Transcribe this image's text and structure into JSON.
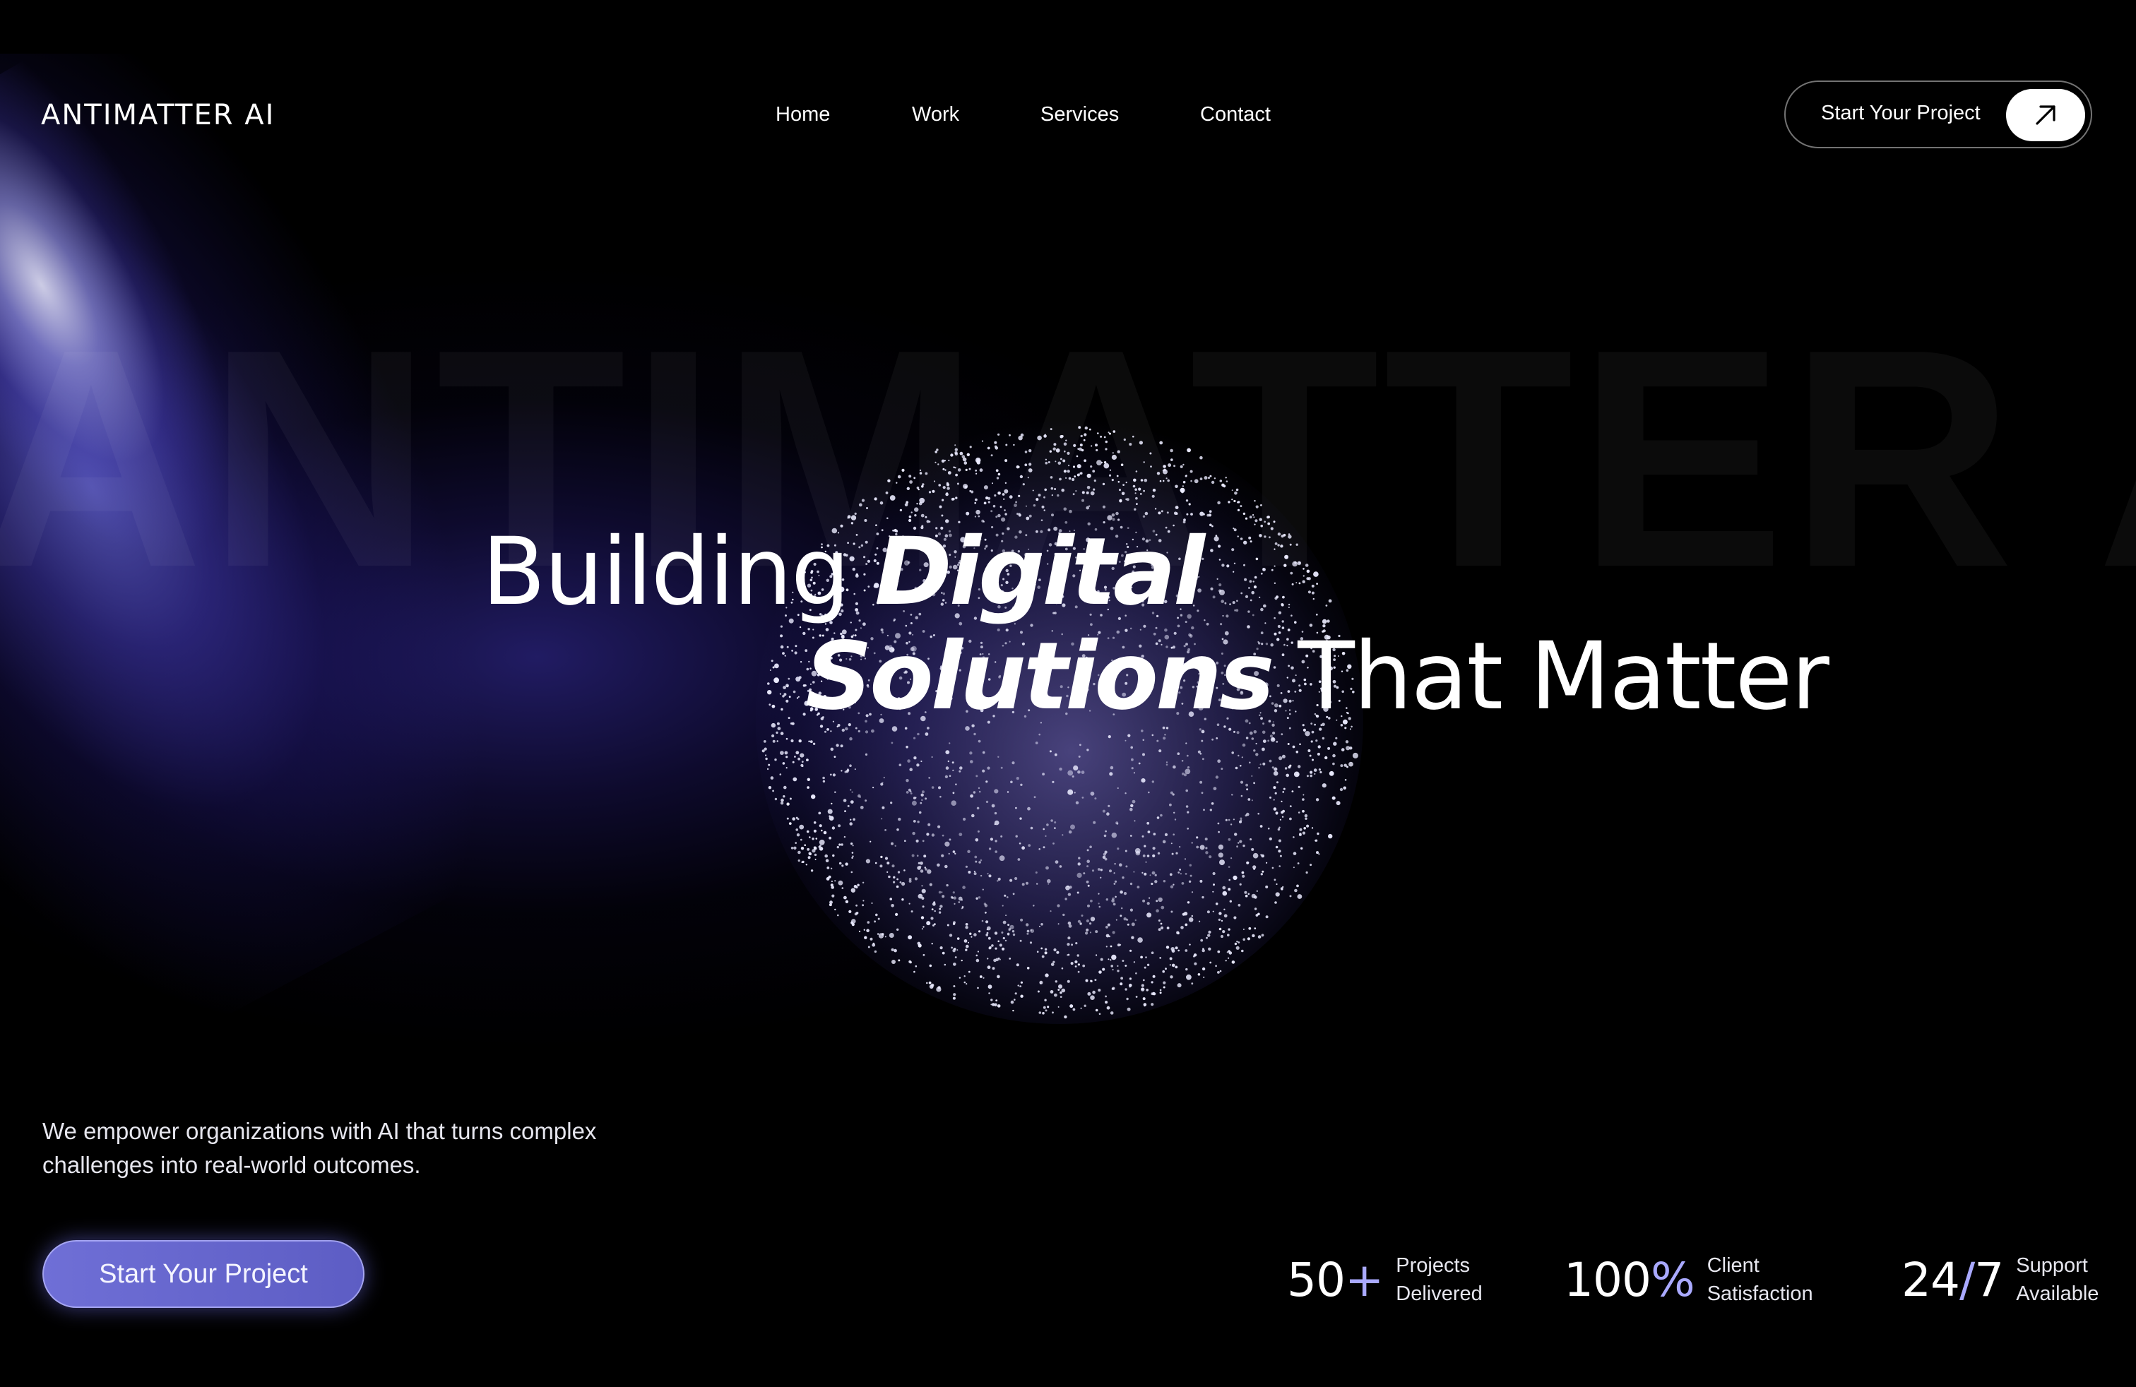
{
  "brand": {
    "logo": "ANTIMATTER AI",
    "watermark": "ANTIMATTER AI"
  },
  "nav": {
    "items": [
      {
        "label": "Home"
      },
      {
        "label": "Work"
      },
      {
        "label": "Services"
      },
      {
        "label": "Contact"
      }
    ]
  },
  "header_cta": {
    "label": "Start Your Project",
    "icon": "arrow-up-right-icon"
  },
  "hero": {
    "line1_light": "Building",
    "line1_bold": "Digital",
    "line2_bold": "Solutions",
    "line2_light": "That Matter",
    "description_line1": "We empower organizations with AI that turns complex",
    "description_line2": "challenges into real-world outcomes.",
    "cta_label": "Start Your Project"
  },
  "stats": [
    {
      "value": "50",
      "accent": "+",
      "label_line1": "Projects",
      "label_line2": "Delivered"
    },
    {
      "value": "100",
      "accent": "%",
      "label_line1": "Client",
      "label_line2": "Satisfaction"
    },
    {
      "value": "24",
      "accent": "/",
      "value_after": "7",
      "label_line1": "Support",
      "label_line2": "Available"
    }
  ],
  "colors": {
    "background": "#000000",
    "accent": "#6f6fd6",
    "accent_light": "#a9a9ff",
    "text": "#ffffff"
  }
}
